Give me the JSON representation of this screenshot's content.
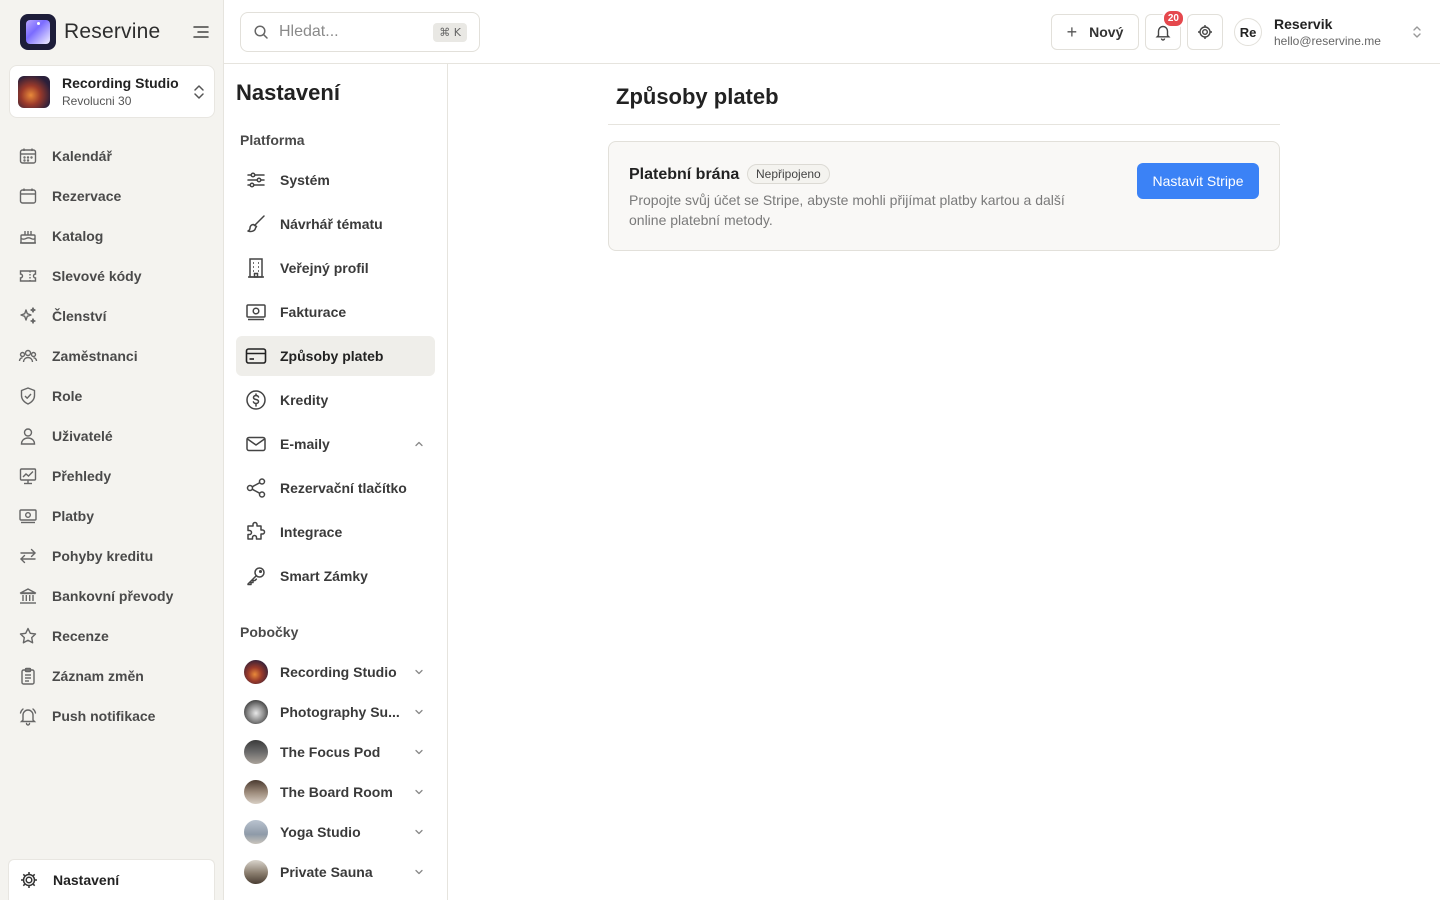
{
  "brand": {
    "name": "Reservine"
  },
  "studio": {
    "name": "Recording Studio",
    "address": "Revolucni 30"
  },
  "sidebar": {
    "items": [
      {
        "label": "Kalendář"
      },
      {
        "label": "Rezervace"
      },
      {
        "label": "Katalog"
      },
      {
        "label": "Slevové kódy"
      },
      {
        "label": "Členství"
      },
      {
        "label": "Zaměstnanci"
      },
      {
        "label": "Role"
      },
      {
        "label": "Uživatelé"
      },
      {
        "label": "Přehledy"
      },
      {
        "label": "Platby"
      },
      {
        "label": "Pohyby kreditu"
      },
      {
        "label": "Bankovní převody"
      },
      {
        "label": "Recenze"
      },
      {
        "label": "Záznam změn"
      },
      {
        "label": "Push notifikace"
      }
    ],
    "settings_label": "Nastavení"
  },
  "topbar": {
    "search_placeholder": "Hledat...",
    "search_shortcut": "⌘ K",
    "new_label": "Nový",
    "notification_count": "20",
    "user": {
      "initials": "Re",
      "name": "Reservik",
      "email": "hello@reservine.me"
    }
  },
  "settings": {
    "title": "Nastavení",
    "platform_label": "Platforma",
    "platform_items": [
      {
        "label": "Systém"
      },
      {
        "label": "Návrhář tématu"
      },
      {
        "label": "Veřejný profil"
      },
      {
        "label": "Fakturace"
      },
      {
        "label": "Způsoby plateb",
        "active": true
      },
      {
        "label": "Kredity"
      },
      {
        "label": "E-maily"
      },
      {
        "label": "Rezervační tlačítko"
      },
      {
        "label": "Integrace"
      },
      {
        "label": "Smart Zámky"
      }
    ],
    "branches_label": "Pobočky",
    "branches": [
      {
        "label": "Recording Studio"
      },
      {
        "label": "Photography Su..."
      },
      {
        "label": "The Focus Pod"
      },
      {
        "label": "The Board Room"
      },
      {
        "label": "Yoga Studio"
      },
      {
        "label": "Private Sauna"
      }
    ]
  },
  "main": {
    "title": "Způsoby plateb",
    "gateway": {
      "title": "Platební brána",
      "status": "Nepřipojeno",
      "description": "Propojte svůj účet se Stripe, abyste mohli přijímat platby kartou a další online platební metody.",
      "button_label": "Nastavit Stripe"
    }
  },
  "colors": {
    "accent": "#3b82f6",
    "notification": "#e5484d",
    "sidebar_bg": "#f4f3ef"
  }
}
